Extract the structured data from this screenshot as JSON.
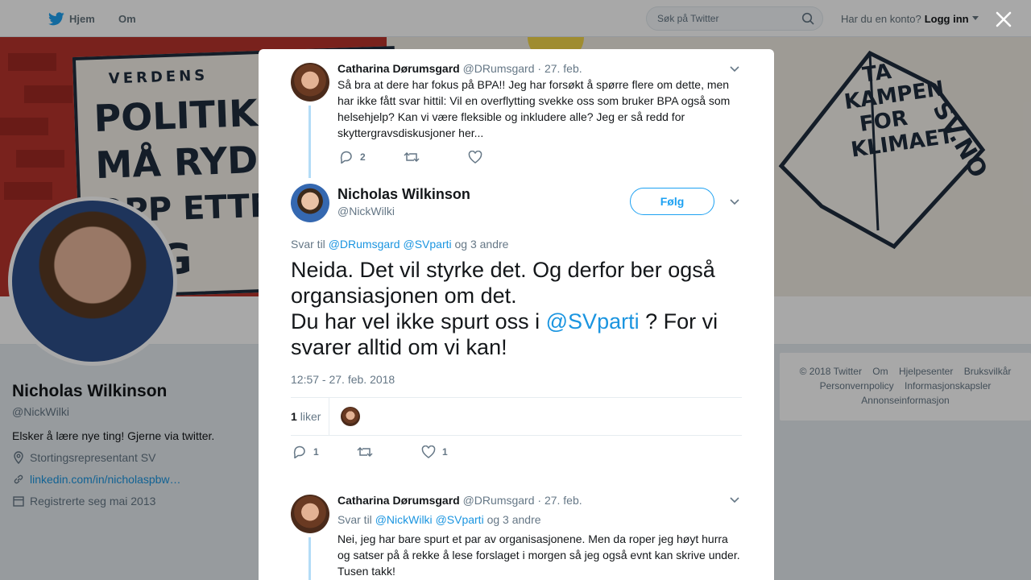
{
  "nav": {
    "home_label": "Hjem",
    "about_label": "Om",
    "search_placeholder": "Søk på Twitter",
    "account_prompt": "Har du en konto?",
    "login_label": "Logg inn"
  },
  "banner": {
    "poster_lines": [
      "VERDENS",
      "POLITIKERE",
      "MÅ RYDDE",
      "OPP ETTER",
      "SEG"
    ],
    "book_lines": [
      "TA",
      "KAMPEN",
      "FOR",
      "KLIMAET",
      "SV.NO"
    ]
  },
  "profile": {
    "name": "Nicholas Wilkinson",
    "handle": "@NickWilki",
    "bio": "Elsker å lære nye ting! Gjerne via twitter.",
    "location": "Stortingsrepresentant SV",
    "url": "linkedin.com/in/nicholaspbw…",
    "joined": "Registrerte seg mai 2013"
  },
  "footer": {
    "links": [
      "© 2018 Twitter",
      "Om",
      "Hjelpesenter",
      "Bruksvilkår",
      "Personvernpolicy",
      "Informasjonskapsler",
      "Annonseinformasjon"
    ]
  },
  "modal": {
    "parent_tweet": {
      "name": "Catharina Dørumsgard",
      "handle": "@DRumsgard",
      "date": "· 27. feb.",
      "text": "Så bra at dere har fokus på BPA!! Jeg har forsøkt å spørre flere om dette, men har ikke fått svar hittil: Vil en overflytting svekke oss som bruker BPA også som helsehjelp? Kan vi være fleksible og inkludere alle? Jeg er så redd for skyttergravsdiskusjoner her...",
      "reply_count": "2"
    },
    "main_tweet": {
      "name": "Nicholas Wilkinson",
      "handle": "@NickWilki",
      "follow_label": "Følg",
      "reply_prefix": "Svar til",
      "reply_mention1": "@DRumsgard",
      "reply_mention2": "@SVparti",
      "reply_suffix": "og 3 andre",
      "line1": "Neida. Det vil styrke det. Og derfor ber også organsiasjonen om det.",
      "line2_a": "Du har vel ikke spurt oss i",
      "line2_mention": "@SVparti",
      "line2_b": "? For vi svarer alltid om vi kan!",
      "timestamp": "12:57 - 27. feb. 2018",
      "likes_number": "1",
      "likes_label": "liker",
      "reply_count": "1",
      "like_count": "1"
    },
    "reply_tweet": {
      "name": "Catharina Dørumsgard",
      "handle": "@DRumsgard",
      "date": "· 27. feb.",
      "reply_prefix": "Svar til",
      "reply_mention1": "@NickWilki",
      "reply_mention2": "@SVparti",
      "reply_suffix": "og 3 andre",
      "text": "Nei, jeg har bare spurt et par av organisasjonene. Men da roper jeg høyt hurra og satser på å rekke å lese forslaget i morgen så jeg også evnt kan skrive under. Tusen takk!"
    }
  },
  "colors": {
    "accent": "#1da1f2",
    "link": "#1b95e0",
    "thread_line": "#b3dcf7"
  }
}
